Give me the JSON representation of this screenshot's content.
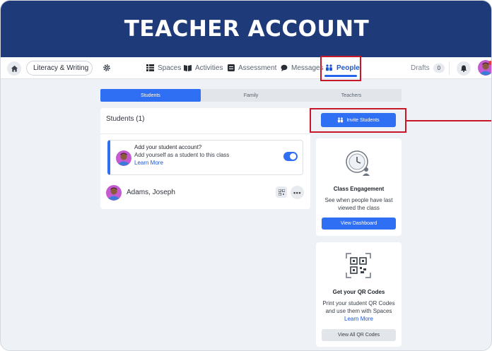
{
  "banner": {
    "title": "TEACHER ACCOUNT"
  },
  "topnav": {
    "class_name": "Literacy & Writing",
    "items": [
      {
        "label": "Spaces",
        "icon": "spaces-icon"
      },
      {
        "label": "Activities",
        "icon": "activities-icon"
      },
      {
        "label": "Assessment",
        "icon": "assessment-icon"
      },
      {
        "label": "Messages",
        "icon": "messages-icon"
      },
      {
        "label": "People",
        "icon": "people-icon",
        "active": true
      }
    ],
    "drafts_label": "Drafts",
    "drafts_count": "0"
  },
  "tabs": [
    {
      "label": "Students",
      "active": true
    },
    {
      "label": "Family",
      "active": false
    },
    {
      "label": "Teachers",
      "active": false
    }
  ],
  "students": {
    "header": "Students (1)",
    "add_card": {
      "title": "Add your student account?",
      "subtitle": "Add yourself as a student to this class",
      "link": "Learn More",
      "toggle_on": true
    },
    "rows": [
      {
        "name": "Adams, Joseph"
      }
    ]
  },
  "invite": {
    "label": "Invite Students"
  },
  "engagement": {
    "title": "Class Engagement",
    "text": "See when people have last viewed the class",
    "button": "View Dashboard"
  },
  "qr": {
    "title": "Get your QR Codes",
    "text": "Print your student QR Codes and use them with Spaces",
    "link": "Learn More",
    "button": "View All QR Codes"
  },
  "colors": {
    "banner": "#1e3a78",
    "accent": "#2f6ff4",
    "highlight": "#c8162b",
    "background": "#eef1f5"
  }
}
